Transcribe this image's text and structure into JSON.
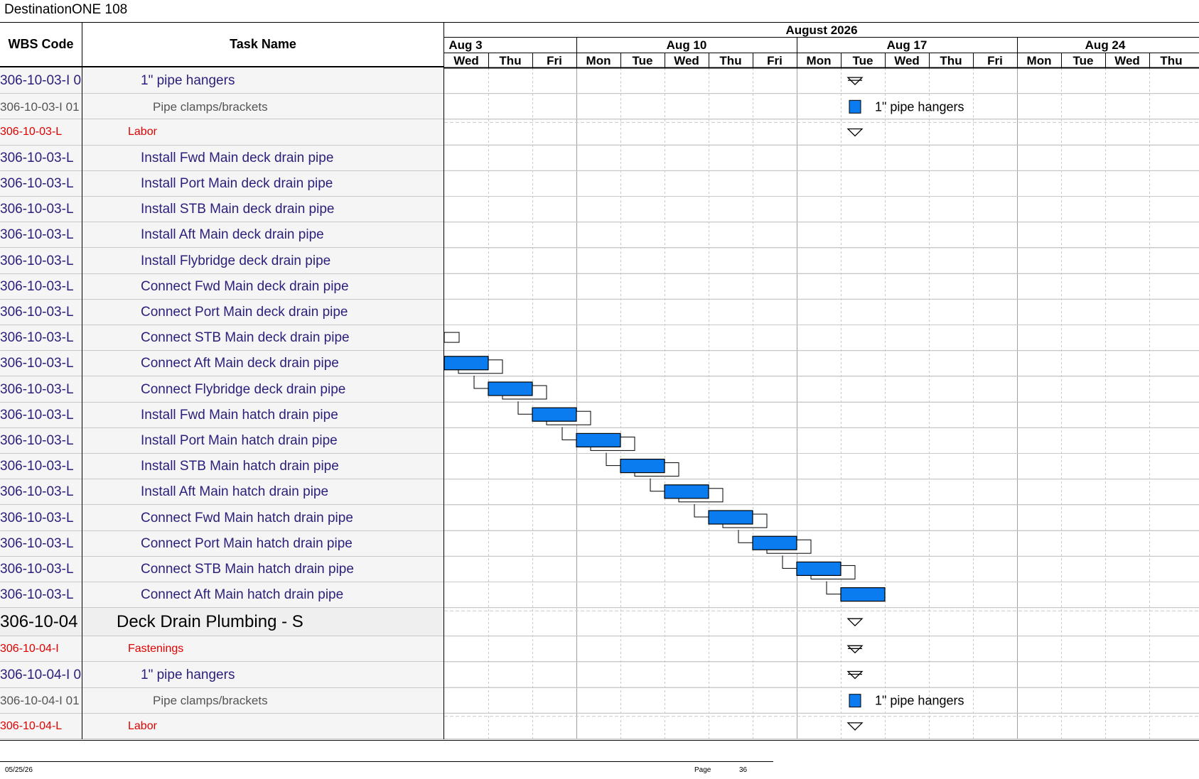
{
  "title": "DestinationONE 108",
  "columns": {
    "wbs": "WBS Code",
    "task": "Task Name"
  },
  "timeline": {
    "month": "August 2026",
    "weeks": [
      "Aug 3",
      "Aug 10",
      "Aug 17",
      "Aug 24"
    ],
    "days": [
      "Wed",
      "Thu",
      "Fri",
      "Mon",
      "Tue",
      "Wed",
      "Thu",
      "Fri",
      "Mon",
      "Tue",
      "Wed",
      "Thu",
      "Fri",
      "Mon",
      "Tue",
      "Wed",
      "Thu"
    ]
  },
  "rows": [
    {
      "wbs": "306-10-03-I 0",
      "task": "1\" pipe hangers",
      "style": "item",
      "indent": 1
    },
    {
      "wbs": "306-10-03-I 01",
      "task": "Pipe clamps/brackets",
      "style": "sub",
      "indent": 2
    },
    {
      "wbs": "306-10-03-L",
      "task": "Labor",
      "style": "red",
      "indent": 0
    },
    {
      "wbs": "306-10-03-L",
      "task": "Install Fwd Main deck drain pipe",
      "style": "item",
      "indent": 1
    },
    {
      "wbs": "306-10-03-L",
      "task": "Install Port Main deck drain pipe",
      "style": "item",
      "indent": 1
    },
    {
      "wbs": "306-10-03-L",
      "task": "Install STB Main deck drain pipe",
      "style": "item",
      "indent": 1
    },
    {
      "wbs": "306-10-03-L",
      "task": "Install Aft Main deck drain pipe",
      "style": "item",
      "indent": 1
    },
    {
      "wbs": "306-10-03-L",
      "task": "Install Flybridge deck drain pipe",
      "style": "item",
      "indent": 1
    },
    {
      "wbs": "306-10-03-L",
      "task": "Connect Fwd Main deck drain pipe",
      "style": "item",
      "indent": 1
    },
    {
      "wbs": "306-10-03-L",
      "task": "Connect Port Main deck drain pipe",
      "style": "item",
      "indent": 1
    },
    {
      "wbs": "306-10-03-L",
      "task": "Connect STB Main deck drain pipe",
      "style": "item",
      "indent": 1
    },
    {
      "wbs": "306-10-03-L",
      "task": "Connect Aft Main deck drain pipe",
      "style": "item",
      "indent": 1
    },
    {
      "wbs": "306-10-03-L",
      "task": "Connect Flybridge deck drain pipe",
      "style": "item",
      "indent": 1
    },
    {
      "wbs": "306-10-03-L",
      "task": "Install Fwd Main hatch drain pipe",
      "style": "item",
      "indent": 1
    },
    {
      "wbs": "306-10-03-L",
      "task": "Install Port Main hatch drain pipe",
      "style": "item",
      "indent": 1
    },
    {
      "wbs": "306-10-03-L",
      "task": "Install STB Main hatch drain pipe",
      "style": "item",
      "indent": 1
    },
    {
      "wbs": "306-10-03-L",
      "task": "Install Aft Main hatch drain pipe",
      "style": "item",
      "indent": 1
    },
    {
      "wbs": "306-10-03-L",
      "task": "Connect Fwd Main hatch drain pipe",
      "style": "item",
      "indent": 1
    },
    {
      "wbs": "306-10-03-L",
      "task": "Connect Port Main hatch drain pipe",
      "style": "item",
      "indent": 1
    },
    {
      "wbs": "306-10-03-L",
      "task": "Connect STB Main hatch drain pipe",
      "style": "item",
      "indent": 1
    },
    {
      "wbs": "306-10-03-L",
      "task": "Connect Aft Main hatch drain pipe",
      "style": "item",
      "indent": 1
    },
    {
      "wbs": "306-10-04",
      "task": "Deck Drain Plumbing - S",
      "style": "summary",
      "indent": 0
    },
    {
      "wbs": "306-10-04-I",
      "task": "Fastenings",
      "style": "red",
      "indent": 0
    },
    {
      "wbs": "306-10-04-I 0",
      "task": "1\" pipe hangers",
      "style": "item",
      "indent": 1
    },
    {
      "wbs": "306-10-04-I 01",
      "task": "Pipe clamps/brackets",
      "style": "sub",
      "indent": 2
    },
    {
      "wbs": "306-10-04-L",
      "task": "Labor",
      "style": "red",
      "indent": 0
    }
  ],
  "gantt": {
    "colors": {
      "bar": "#0a7cf0",
      "bar_border": "#000000",
      "red": "#e00000",
      "task": "#2a1f7a",
      "sub": "#555555"
    },
    "bar_labels": [
      "1\" pipe hangers",
      "1\" pipe hangers"
    ]
  },
  "footer": {
    "date": "05/25/26",
    "page_label": "Page",
    "page_number": "36"
  }
}
